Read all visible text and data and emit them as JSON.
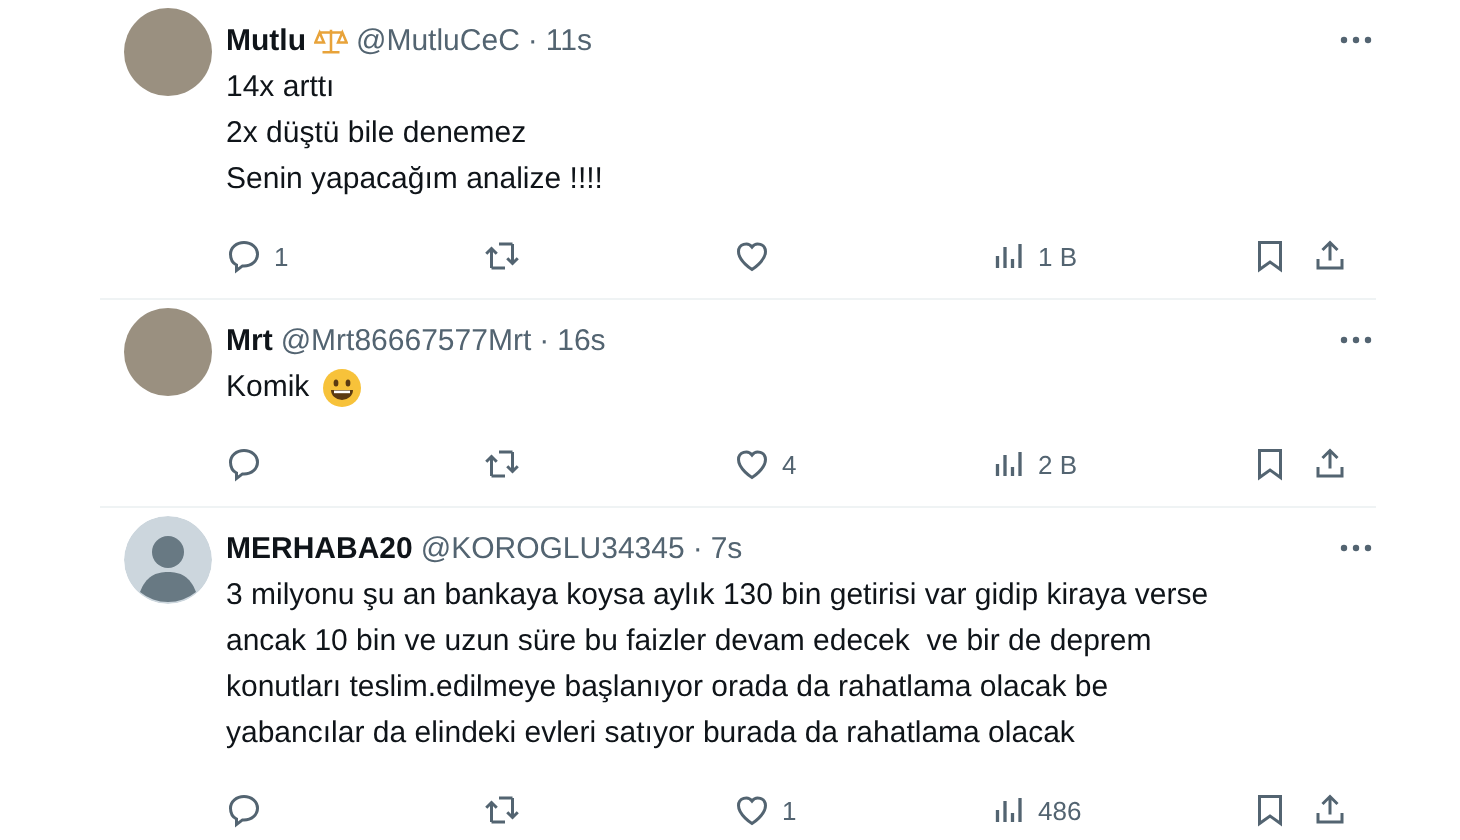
{
  "tweets": [
    {
      "kind": "photo",
      "name": "Mutlu",
      "badge": true,
      "handle": "@MutluCeC",
      "separator": "·",
      "time": "11s",
      "text": "14x arttı\n2x düştü bile denemez\nSenin yapacağım analize !!!!",
      "emoji": false,
      "replies": "1",
      "views": "1 B"
    },
    {
      "kind": "photo",
      "name": "Mrt",
      "badge": false,
      "handle": "@Mrt86667577Mrt",
      "separator": "·",
      "time": "16s",
      "text": "Komik",
      "emoji": true,
      "likes": "4",
      "views": "2 B"
    },
    {
      "kind": "default",
      "name": "MERHABA20",
      "badge": false,
      "handle": "@KOROGLU34345",
      "separator": "·",
      "time": "7s",
      "text": "3 milyonu şu an bankaya koysa aylık 130 bin getirisi var gidip kiraya verse\nancak 10 bin ve uzun süre bu faizler devam edecek  ve bir de deprem\nkonutları teslim.edilmeye başlanıyor orada da rahatlama olacak be\nyabancılar da elindeki evleri satıyor burada da rahatlama olacak",
      "emoji": false,
      "likes": "1",
      "views": "486"
    }
  ]
}
